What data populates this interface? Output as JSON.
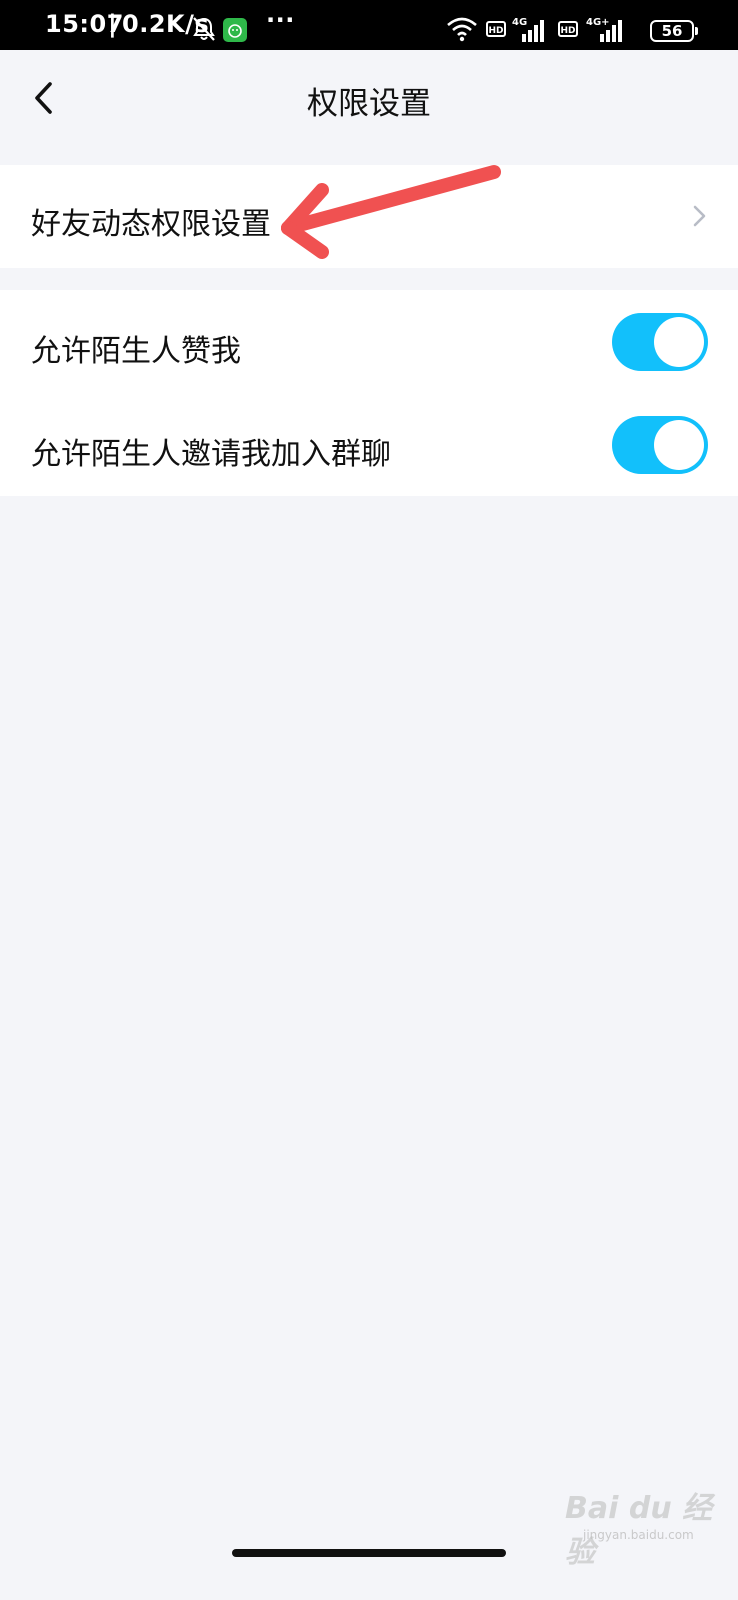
{
  "status_bar": {
    "time": "15:07",
    "separator": "|",
    "net_speed": "0.2K/s",
    "more": "···",
    "hd_1": "HD",
    "net_1": "4G",
    "hd_2": "HD",
    "net_2": "4G+",
    "battery": "56",
    "icons": [
      "mute-bell-icon",
      "app-notification-icon",
      "wifi-icon",
      "signal-icon",
      "battery-icon"
    ]
  },
  "header": {
    "title": "权限设置",
    "back_icon": "chevron-left-icon"
  },
  "settings": {
    "friend_feed_permissions": "好友动态权限设置",
    "allow_stranger_likes": {
      "label": "允许陌生人赞我",
      "enabled": true
    },
    "allow_stranger_group_invites": {
      "label": "允许陌生人邀请我加入群聊",
      "enabled": true
    }
  },
  "watermark": {
    "brand": "Bai du 经验",
    "url": "jingyan.baidu.com"
  },
  "colors": {
    "accent": "#12c0fb",
    "background": "#f4f5f9",
    "card": "#ffffff",
    "annotation": "#f05151"
  }
}
